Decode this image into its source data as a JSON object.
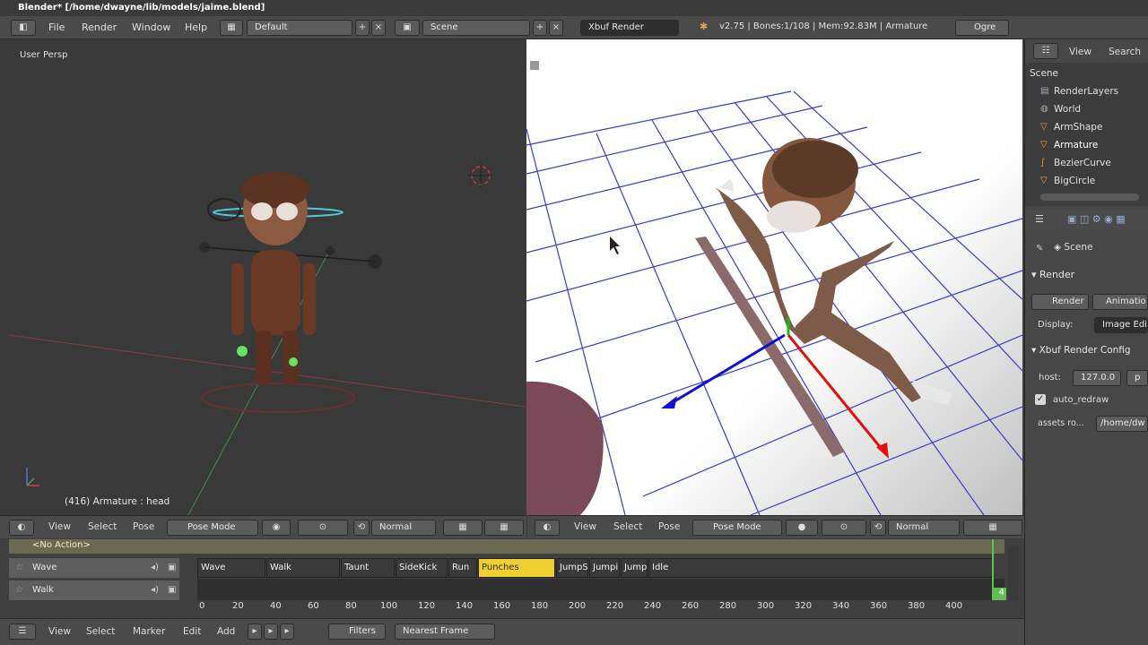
{
  "title": "Blender* [/home/dwayne/lib/models/jaime.blend]",
  "menu": [
    "File",
    "Render",
    "Window",
    "Help"
  ],
  "layout_name": "Default",
  "scene_name": "Scene",
  "render_engine": "Xbuf Render",
  "stats": "v2.75 | Bones:1/108 | Mem:92.83M | Armature",
  "ogre_label": "Ogre",
  "left_viewport": {
    "label": "User Persp",
    "status": "(416) Armature : head"
  },
  "viewport_header": {
    "view": "View",
    "select": "Select",
    "pose": "Pose",
    "mode": "Pose Mode",
    "shading": "Normal"
  },
  "outliner": {
    "view": "View",
    "search": "Search",
    "items": [
      "Scene",
      "RenderLayers",
      "World",
      "ArmShape",
      "Armature",
      "BezierCurve",
      "BigCircle"
    ]
  },
  "properties": {
    "context": "Scene",
    "render_section": "Render",
    "render_btn": "Render",
    "animation_btn": "Animatio",
    "display_label": "Display:",
    "display_value": "Image Edi",
    "xbuf_section": "Xbuf Render Config",
    "host_label": "host:",
    "host_value": "127.0.0",
    "port_value": "p",
    "auto_redraw": "auto_redraw",
    "assets_label": "assets ro...",
    "assets_value": "/home/dw"
  },
  "nla": {
    "action": "<No Action>",
    "tracks": [
      "Wave",
      "Walk"
    ],
    "strips": [
      "Wave",
      "Walk",
      "Taunt",
      "SideKick",
      "Run",
      "Punches",
      "JumpSt",
      "Jumping",
      "JumpEnd",
      "Idle"
    ],
    "ticks": [
      "0",
      "20",
      "40",
      "60",
      "80",
      "100",
      "120",
      "140",
      "160",
      "180",
      "200",
      "220",
      "240",
      "260",
      "280",
      "300",
      "320",
      "340",
      "360",
      "380",
      "400"
    ],
    "frame": "4"
  },
  "bottom_header": {
    "view": "View",
    "select": "Select",
    "marker": "Marker",
    "edit": "Edit",
    "add": "Add",
    "filters": "Filters",
    "snap": "Nearest Frame"
  }
}
